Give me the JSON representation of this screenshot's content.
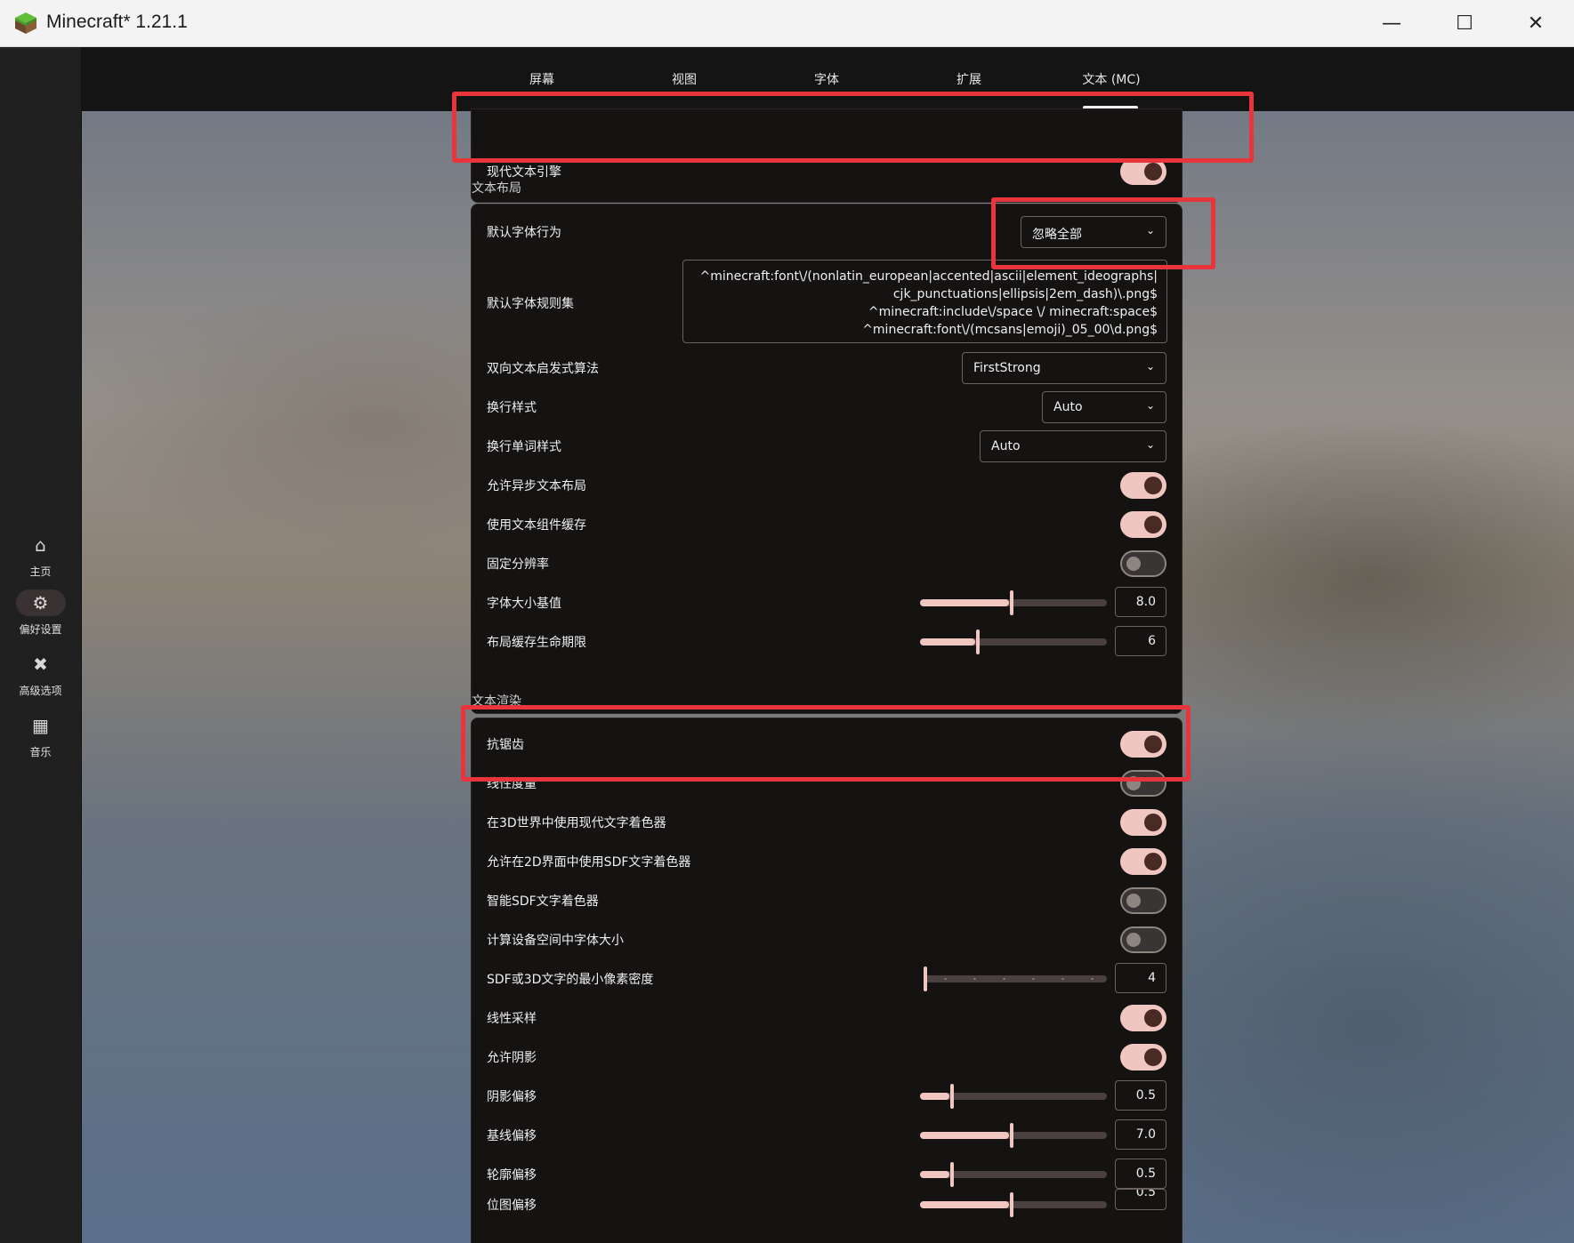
{
  "window": {
    "title": "Minecraft* 1.21.1",
    "app_icon": "minecraft-grass-block-icon",
    "controls": {
      "minimize": "—",
      "maximize": "☐",
      "close": "✕"
    }
  },
  "rail": {
    "items": [
      {
        "label": "主页",
        "icon": "⌂"
      },
      {
        "label": "偏好设置",
        "icon": "⚙"
      },
      {
        "label": "高级选项",
        "icon": "✖"
      },
      {
        "label": "音乐",
        "icon": "▦"
      }
    ]
  },
  "tabs": [
    "屏幕",
    "视图",
    "字体",
    "扩展",
    "文本 (MC)"
  ],
  "modern_text": {
    "label": "现代文本引擎",
    "on": true
  },
  "layout": {
    "title": "文本布局",
    "default_font_behavior": {
      "label": "默认字体行为",
      "value": "忽略全部"
    },
    "default_font_rules": {
      "label": "默认字体规则集",
      "lines": [
        "^minecraft:font\\/(nonlatin_european|accented|ascii|element_ideographs|",
        "cjk_punctuations|ellipsis|2em_dash)\\.png$",
        "^minecraft:include\\/space \\/ minecraft:space$",
        "^minecraft:font\\/(mcsans|emoji)_05_00\\d.png$"
      ]
    },
    "bidi": {
      "label": "双向文本启发式算法",
      "value": "FirstStrong"
    },
    "line_break_style": {
      "label": "换行样式",
      "value": "Auto"
    },
    "line_break_word_style": {
      "label": "换行单词样式",
      "value": "Auto"
    },
    "async_layout": {
      "label": "允许异步文本布局",
      "on": true
    },
    "component_cache": {
      "label": "使用文本组件缓存",
      "on": true
    },
    "fixed_resolution": {
      "label": "固定分辨率",
      "on": false
    },
    "font_size_base": {
      "label": "字体大小基值",
      "value": "8.0",
      "fraction": 0.49
    },
    "layout_cache_life": {
      "label": "布局缓存生命期限",
      "value": "6",
      "fraction": 0.31
    }
  },
  "render": {
    "title": "文本渲染",
    "antialias": {
      "label": "抗锯齿",
      "on": true
    },
    "linear_metrics": {
      "label": "线性度量",
      "on": false
    },
    "modern_shader_3d": {
      "label": "在3D世界中使用现代文字着色器",
      "on": true
    },
    "sdf_shader_2d": {
      "label": "允许在2D界面中使用SDF文字着色器",
      "on": true
    },
    "smart_sdf": {
      "label": "智能SDF文字着色器",
      "on": false
    },
    "device_space_font": {
      "label": "计算设备空间中字体大小",
      "on": false
    },
    "min_pixel_density": {
      "label": "SDF或3D文字的最小像素密度",
      "value": "4",
      "fraction": 0.0
    },
    "linear_sampling": {
      "label": "线性采样",
      "on": true
    },
    "allow_shadow": {
      "label": "允许阴影",
      "on": true
    },
    "shadow_offset": {
      "label": "阴影偏移",
      "value": "0.5",
      "fraction": 0.17
    },
    "baseline_offset": {
      "label": "基线偏移",
      "value": "7.0",
      "fraction": 0.49
    },
    "outline_offset": {
      "label": "轮廓偏移",
      "value": "0.5",
      "fraction": 0.17
    },
    "bitmap_offset": {
      "label": "位图偏移",
      "value": "0.5",
      "fraction": 0.49
    }
  },
  "colors": {
    "accent": "#f0c7c0",
    "highlight": "#e8353b",
    "panel": "#151212"
  }
}
